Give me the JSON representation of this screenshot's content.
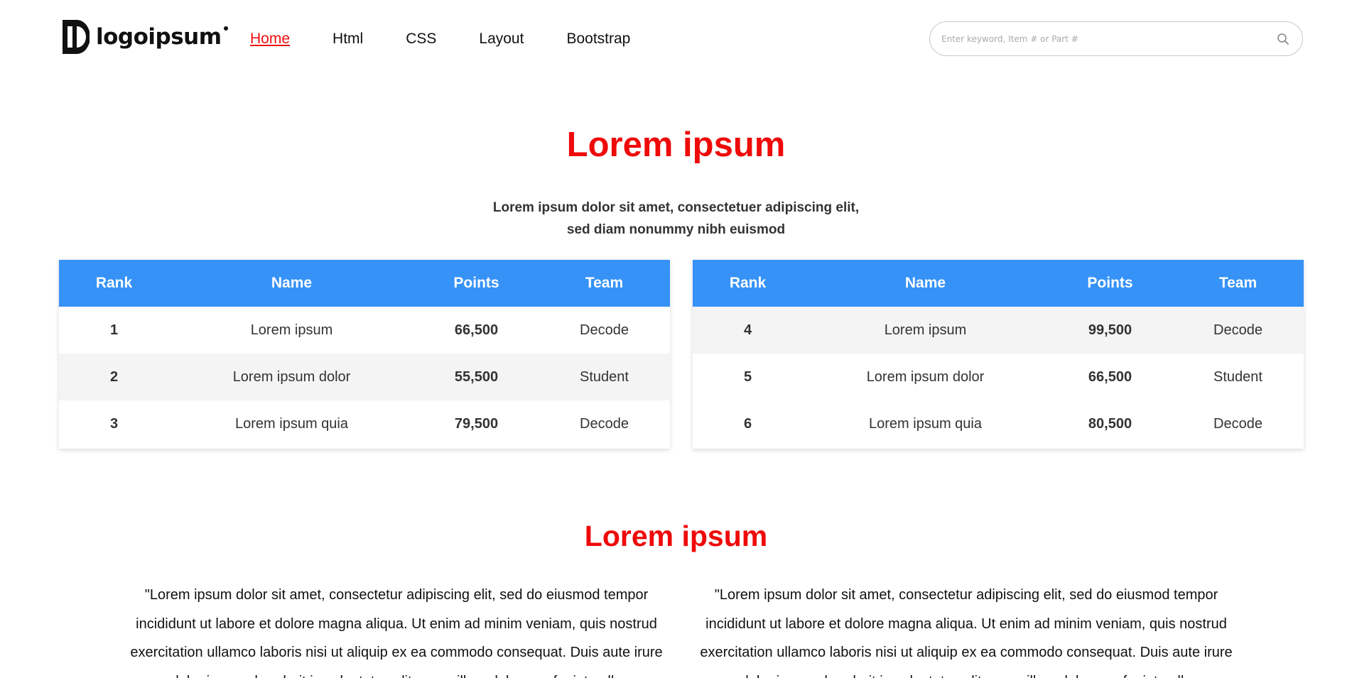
{
  "brand": {
    "logo_text": "logoipsum"
  },
  "nav": [
    {
      "label": "Home",
      "active": true
    },
    {
      "label": "Html",
      "active": false
    },
    {
      "label": "CSS",
      "active": false
    },
    {
      "label": "Layout",
      "active": false
    },
    {
      "label": "Bootstrap",
      "active": false
    }
  ],
  "search": {
    "placeholder": "Enter keyword, Item # or Part #",
    "icon": "search-icon"
  },
  "section1": {
    "title": "Lorem ipsum",
    "subtitle_line1": "Lorem ipsum dolor sit amet, consectetuer adipiscing elit,",
    "subtitle_line2": "sed diam nonummy nibh euismod"
  },
  "table_headers": [
    "Rank",
    "Name",
    "Points",
    "Team"
  ],
  "table_left": [
    {
      "rank": "1",
      "name": "Lorem ipsum",
      "points": "66,500",
      "team": "Decode"
    },
    {
      "rank": "2",
      "name": "Lorem ipsum dolor",
      "points": "55,500",
      "team": "Student"
    },
    {
      "rank": "3",
      "name": "Lorem ipsum quia",
      "points": "79,500",
      "team": "Decode"
    }
  ],
  "table_right": [
    {
      "rank": "4",
      "name": "Lorem ipsum",
      "points": "99,500",
      "team": "Decode"
    },
    {
      "rank": "5",
      "name": "Lorem ipsum dolor",
      "points": "66,500",
      "team": "Student"
    },
    {
      "rank": "6",
      "name": "Lorem ipsum quia",
      "points": "80,500",
      "team": "Decode"
    }
  ],
  "section2": {
    "title": "Lorem ipsum",
    "para_left": "\"Lorem ipsum dolor sit amet, consectetur adipiscing elit, sed do eiusmod tempor incididunt ut labore et dolore magna aliqua. Ut enim ad minim veniam, quis nostrud exercitation ullamco laboris nisi ut aliquip ex ea commodo consequat. Duis aute irure dolor in reprehenderit in voluptate velit esse cillum dolore eu fugiat nulla",
    "para_right": "\"Lorem ipsum dolor sit amet, consectetur adipiscing elit, sed do eiusmod tempor incididunt ut labore et dolore magna aliqua. Ut enim ad minim veniam, quis nostrud exercitation ullamco laboris nisi ut aliquip ex ea commodo consequat. Duis aute irure dolor in reprehenderit in voluptate velit esse cillum dolore eu fugiat nulla"
  },
  "colors": {
    "accent_red": "#ef0a0a",
    "table_header_blue": "#3692f7",
    "row_shade": "#f4f4f4"
  }
}
